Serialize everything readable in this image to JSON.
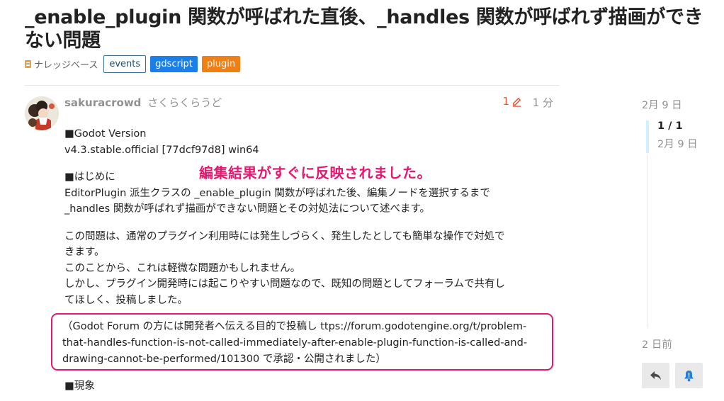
{
  "topic": {
    "title": "_enable_plugin 関数が呼ばれた直後、_handles 関数が呼ばれず描画ができない問題",
    "category": "ナレッジベース",
    "tags": [
      "events",
      "gdscript",
      "plugin"
    ]
  },
  "post": {
    "username": "sakuracrowd",
    "full_name": "さくらくらうど",
    "edit_count": "1",
    "age": "1 分",
    "annotation": "編集結果がすぐに反映されました。",
    "lines": {
      "godot_version_heading": "■Godot Version",
      "godot_version": "v4.3.stable.official [77dcf97d8] win64",
      "intro_heading": "■はじめに",
      "intro_1": "EditorPlugin 派生クラスの _enable_plugin 関数が呼ばれた後、編集ノードを選択するまで",
      "intro_2": "_handles 関数が呼ばれず描画ができない問題とその対処法について述べます。",
      "para_1": "この問題は、通常のプラグイン利用時には発生しづらく、発生したとしても簡単な操作で対処で",
      "para_2": "きます。",
      "para_3": "このことから、これは軽微な問題かもしれません。",
      "para_4": "しかし、プラグイン開発時には起こりやすい問題なので、既知の問題としてフォーラムで共有し",
      "para_5": "てほしく、投稿しました。",
      "quote_1": "（Godot Forum の方には開発者へ伝える目的で投稿し ttps://forum.godotengine.org/t/problem-",
      "quote_2": "that-handles-function-is-not-called-immediately-after-enable-plugin-function-is-called-and-",
      "quote_3": "drawing-cannot-be-performed/101300 で承認・公開されました）",
      "symptom_heading": "■現象"
    }
  },
  "timeline": {
    "start_date": "2月 9 日",
    "position": "1 / 1",
    "current_date": "2月 9 日",
    "last_activity": "2 日前"
  },
  "colors": {
    "annotation": "#e5176e",
    "tag_gdscript": "#1a7fe8",
    "tag_plugin": "#f07f16",
    "edit_indicator": "#e45735"
  },
  "icons": [
    "category-icon",
    "pencil-icon",
    "reply-icon",
    "bell-icon"
  ]
}
